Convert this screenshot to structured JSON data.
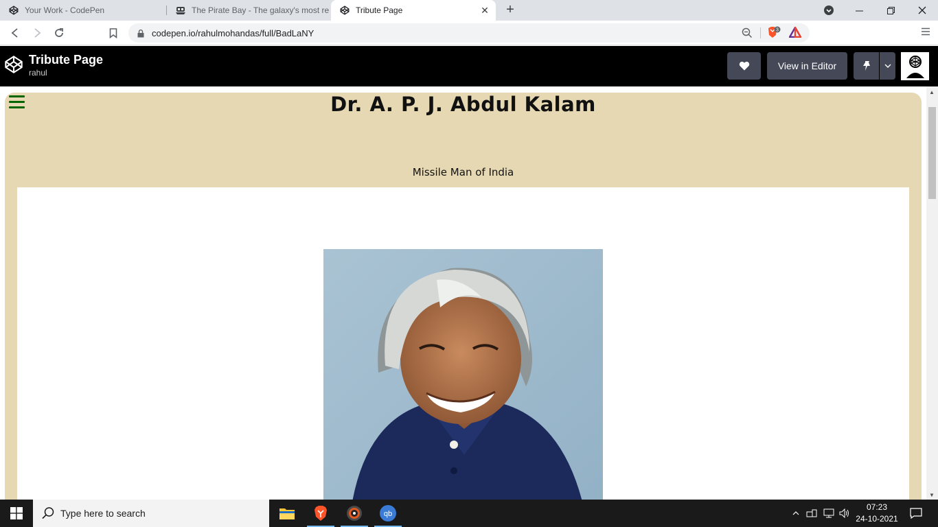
{
  "browser": {
    "tabs": [
      {
        "title": "Your Work - CodePen"
      },
      {
        "title": "The Pirate Bay - The galaxy's most resilient"
      },
      {
        "title": "Tribute Page"
      }
    ],
    "url": "codepen.io/rahulmohandas/full/BadLaNY",
    "shield_count": "3"
  },
  "codepen": {
    "title": "Tribute Page",
    "user": "rahul",
    "view_in_editor": "View in Editor"
  },
  "page": {
    "heading": "Dr. A. P. J. Abdul Kalam",
    "subtitle": "Missile Man of India"
  },
  "taskbar": {
    "search_placeholder": "Type here to search",
    "time": "07:23",
    "date": "24-10-2021"
  },
  "colors": {
    "tribute_background": "#e6d8b2",
    "codepen_header": "#000000",
    "hamburger": "#006400",
    "accent_taskbar": "#76b9ed"
  }
}
